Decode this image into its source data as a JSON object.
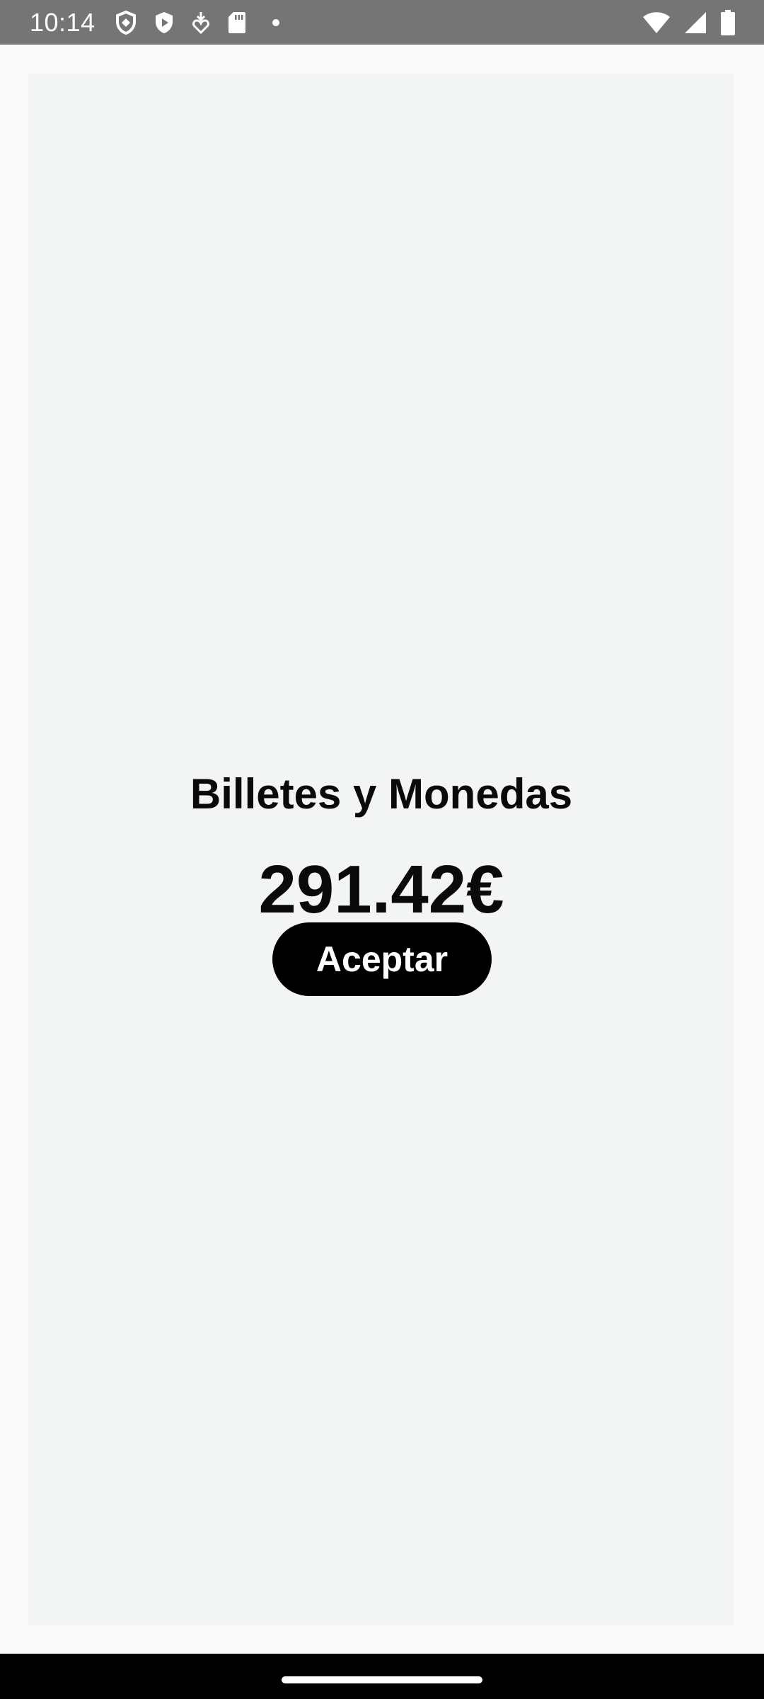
{
  "status_bar": {
    "time": "10:14",
    "left_icons": [
      "shield-outline-icon",
      "play-shield-icon",
      "download-heart-icon",
      "sd-card-icon",
      "dot-icon"
    ],
    "right_icons": [
      "wifi-icon",
      "signal-icon",
      "battery-icon"
    ]
  },
  "main": {
    "title": "Billetes y Monedas",
    "amount": "291.42€",
    "accept_label": "Aceptar"
  },
  "colors": {
    "status_bar": "#757575",
    "card_background": "#f2f5f4",
    "page_background": "#fafafa",
    "button_background": "#000000",
    "button_text": "#ffffff",
    "text": "#0a0a0a"
  }
}
